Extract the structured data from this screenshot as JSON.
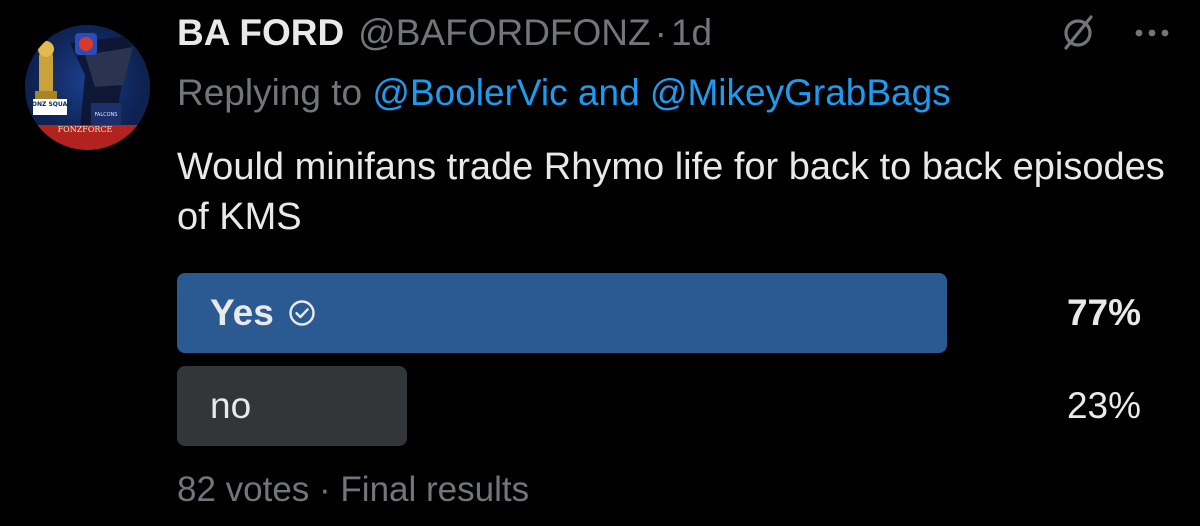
{
  "author": {
    "display_name": "BA FORD",
    "handle": "@BAFORDFONZ",
    "separator": "·",
    "time": "1d",
    "avatar_text": {
      "badge": "FONZ SQUAD",
      "team": "FALCONS",
      "banner": "FONZFORCE"
    }
  },
  "header_icons": [
    "grok-slash-icon",
    "more-dots-icon"
  ],
  "reply": {
    "prefix": "Replying to",
    "mentions": "@BoolerVic and @MikeyGrabBags"
  },
  "body": "Would minifans trade Rhymo life for back to back episodes of KMS",
  "poll": {
    "options": [
      {
        "label": "Yes",
        "percent_text": "77%",
        "fraction": 0.77,
        "winner": true,
        "color": "#2b5a92"
      },
      {
        "label": "no",
        "percent_text": "23%",
        "fraction": 0.23,
        "winner": false,
        "color": "#333639"
      }
    ],
    "footer": "82 votes · Final results"
  },
  "colors": {
    "background": "#000000",
    "text": "#e7e9ea",
    "muted": "#71767b",
    "link": "#1d9bf0"
  }
}
